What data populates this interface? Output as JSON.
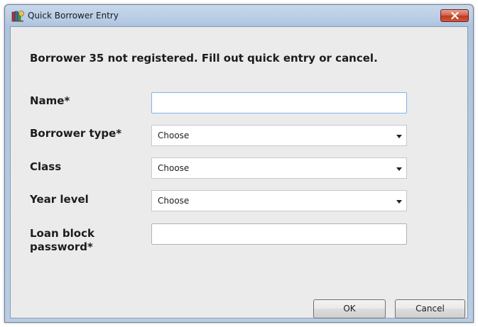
{
  "window": {
    "title": "Quick Borrower Entry",
    "icon": "books-app-icon",
    "close_icon": "close-icon"
  },
  "message": "Borrower 35 not registered. Fill out quick entry or cancel.",
  "form": {
    "name": {
      "label": "Name*",
      "value": ""
    },
    "borrower_type": {
      "label": "Borrower type*",
      "value": "Choose"
    },
    "class": {
      "label": "Class",
      "value": "Choose"
    },
    "year_level": {
      "label": "Year level",
      "value": "Choose"
    },
    "loan_block_password": {
      "label": "Loan block password*",
      "value": ""
    }
  },
  "buttons": {
    "ok": "OK",
    "cancel": "Cancel"
  },
  "colors": {
    "close_button": "#c7432a",
    "focus_border": "#7eb4ea",
    "client_background": "#ebebeb"
  }
}
